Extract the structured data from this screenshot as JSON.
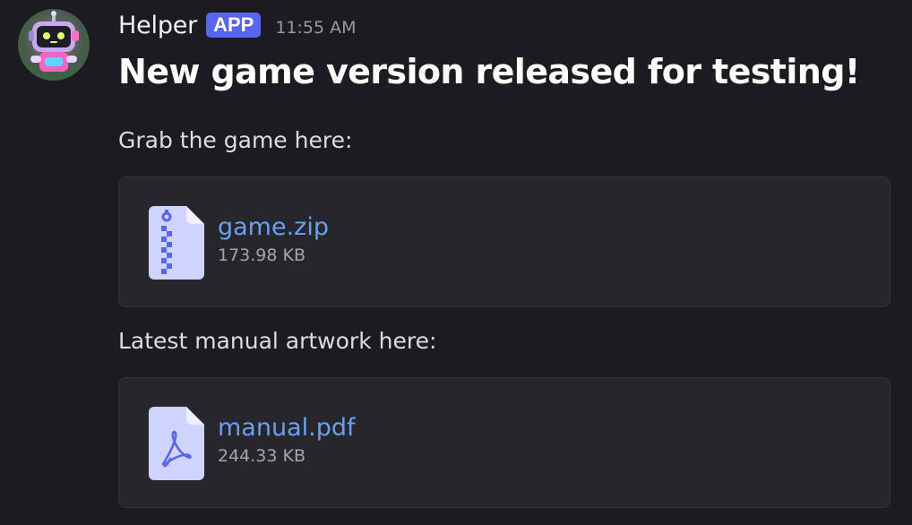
{
  "message": {
    "author": "Helper",
    "badge": "APP",
    "time": "11:55 AM",
    "title": "New game version released for testing!",
    "paragraph_1": "Grab the game here:",
    "paragraph_2": "Latest manual artwork here:"
  },
  "attachments": [
    {
      "name": "game.zip",
      "size": "173.98 KB",
      "icon": "zip-file-icon"
    },
    {
      "name": "manual.pdf",
      "size": "244.33 KB",
      "icon": "pdf-file-icon"
    }
  ],
  "colors": {
    "background": "#1c1c20",
    "badge": "#5865f2",
    "link": "#6b9ff4",
    "file_icon": "#cfd3ff",
    "file_icon_accent": "#5865f2"
  }
}
